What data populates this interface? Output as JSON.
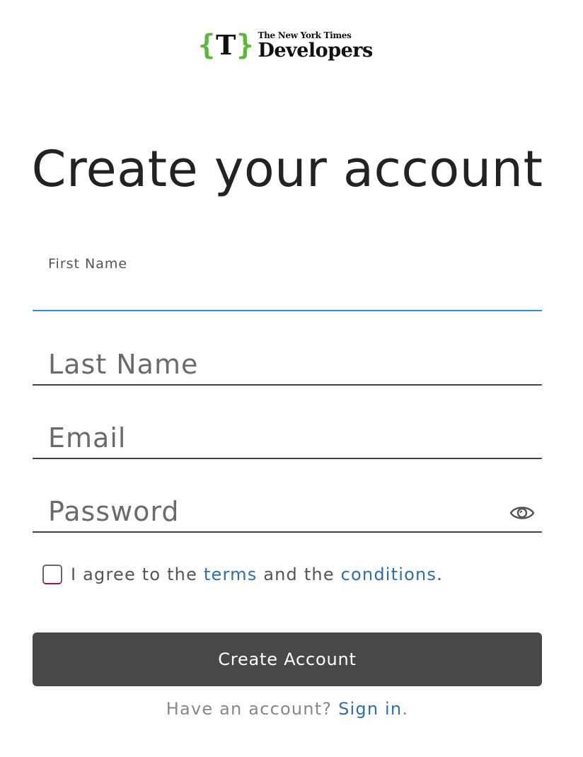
{
  "logo": {
    "brace_open": "{",
    "t_mark": "T",
    "brace_close": "}",
    "nyt_wordmark": "The New York Times",
    "developers_word": "Developers",
    "brace_color": "#5bb83a"
  },
  "title": "Create your account",
  "form": {
    "first_name": {
      "label": "First Name",
      "value": ""
    },
    "last_name": {
      "placeholder": "Last Name",
      "value": ""
    },
    "email": {
      "placeholder": "Email",
      "value": ""
    },
    "password": {
      "placeholder": "Password",
      "value": "",
      "toggle_icon": "eye-icon"
    },
    "agree": {
      "checked": false,
      "prefix": "I agree to the ",
      "terms_link": "terms",
      "middle": " and the ",
      "conditions_link": "conditions",
      "suffix": "."
    },
    "submit_label": "Create Account"
  },
  "signin": {
    "prompt": "Have an account? ",
    "link": "Sign in",
    "suffix": "."
  },
  "colors": {
    "active_underline": "#2b8fd6",
    "link": "#2a6fb0",
    "button_bg": "#484848"
  }
}
